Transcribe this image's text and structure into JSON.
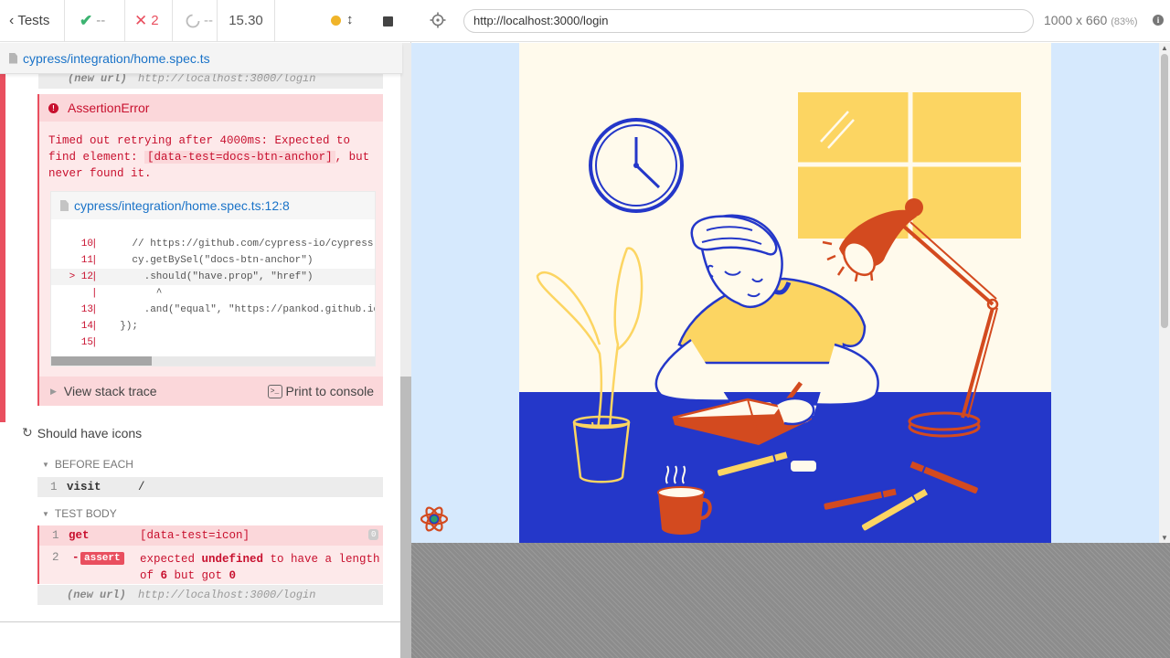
{
  "stats": {
    "tests_label": "Tests",
    "passed": "--",
    "failed": "2",
    "pending": "--",
    "duration": "15.30"
  },
  "spec": {
    "path": "cypress/integration/home.spec.ts"
  },
  "commands": {
    "new_url_label": "(new url)",
    "new_url_value": "http://localhost:3000/login"
  },
  "error": {
    "name": "AssertionError",
    "message_1": "Timed out retrying after 4000ms: Expected to find element:",
    "selector": "[data-test=docs-btn-anchor]",
    "message_2": ", but never found it.",
    "code_frame_path": "cypress/integration/home.spec.ts:12:8",
    "code_lines": [
      {
        "num": "10",
        "src": "    // https://github.com/cypress-io/cypress-e"
      },
      {
        "num": "11",
        "src": "    cy.getBySel(\"docs-btn-anchor\")"
      },
      {
        "num": "> 12",
        "src": "      .should(\"have.prop\", \"href\")"
      },
      {
        "num": "",
        "src": "        ^"
      },
      {
        "num": "13",
        "src": "      .and(\"equal\", \"https://pankod.github.io/"
      },
      {
        "num": "14",
        "src": "  });"
      },
      {
        "num": "15",
        "src": ""
      }
    ],
    "view_stack_trace": "View stack trace",
    "print_to_console": "Print to console"
  },
  "test2": {
    "title": "Should have icons",
    "before_each_label": "BEFORE EACH",
    "visit": {
      "num": "1",
      "name": "visit",
      "msg": "/"
    },
    "test_body_label": "TEST BODY",
    "get": {
      "num": "1",
      "name": "get",
      "msg": "[data-test=icon]",
      "count": "0"
    },
    "assert": {
      "num": "2",
      "dash": "-",
      "name": "assert",
      "msg_parts": [
        "expected ",
        "undefined",
        " to have a length of ",
        "6",
        " but got ",
        "0"
      ]
    },
    "new_url_label": "(new url)",
    "new_url_value": "http://localhost:3000/login"
  },
  "aut": {
    "url": "http://localhost:3000/login",
    "viewport": "1000 x 660",
    "scale": "(83%)"
  },
  "colors": {
    "fail": "#e94f5f",
    "pass": "#3cb371",
    "link": "#1a73c8",
    "illus_blue": "#2437c9",
    "illus_yellow": "#fcd562",
    "illus_red": "#d34a1f",
    "illus_cream": "#fffaec"
  }
}
